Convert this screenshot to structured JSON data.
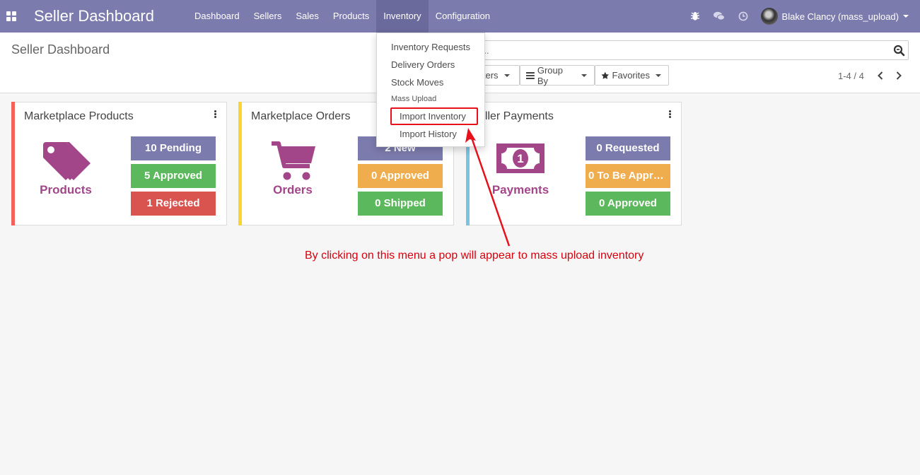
{
  "navbar": {
    "app_title": "Seller Dashboard",
    "menu": [
      "Dashboard",
      "Sellers",
      "Sales",
      "Products",
      "Inventory",
      "Configuration"
    ],
    "active_menu": "Inventory",
    "systray_icons": [
      "bug-icon",
      "chat-icon",
      "clock-icon"
    ],
    "user_name": "Blake Clancy (mass_upload)"
  },
  "control_panel": {
    "breadcrumb": "Seller Dashboard",
    "search_placeholder": "Search...",
    "search_visible_text": "ch...",
    "filters_label": "lters",
    "group_by_label": "Group By",
    "favorites_label": "Favorites",
    "pager": "1-4 / 4"
  },
  "inventory_dropdown": {
    "items": [
      "Inventory Requests",
      "Delivery Orders",
      "Stock Moves"
    ],
    "section_header": "Mass Upload",
    "sub_items": [
      "Import Inventory",
      "Import History"
    ],
    "highlighted": "Import Inventory"
  },
  "cards": [
    {
      "title": "Marketplace Products",
      "label": "Products",
      "icon": "tags-icon",
      "accent": "#f0625a",
      "stats": [
        {
          "text": "10 Pending",
          "color": "#7c7bad"
        },
        {
          "text": "5 Approved",
          "color": "#5cb85c"
        },
        {
          "text": "1 Rejected",
          "color": "#d9534f"
        }
      ]
    },
    {
      "title": "Marketplace Orders",
      "label": "Orders",
      "icon": "cart-icon",
      "accent": "#f9d532",
      "stats": [
        {
          "text": "2 New",
          "color": "#7c7bad"
        },
        {
          "text": "0 Approved",
          "color": "#f0ad4e"
        },
        {
          "text": "0 Shipped",
          "color": "#5cb85c"
        }
      ]
    },
    {
      "title": "Seller Payments",
      "visible_title": "eller Payments",
      "label": "Payments",
      "icon": "money-bill-icon",
      "accent": "#7ac4e2",
      "stats": [
        {
          "text": "0 Requested",
          "color": "#7c7bad"
        },
        {
          "text": "0 To Be Approved",
          "color": "#f0ad4e"
        },
        {
          "text": "0 Approved",
          "color": "#5cb85c"
        }
      ]
    }
  ],
  "annotation": "By clicking on this menu a pop will appear to mass upload inventory"
}
